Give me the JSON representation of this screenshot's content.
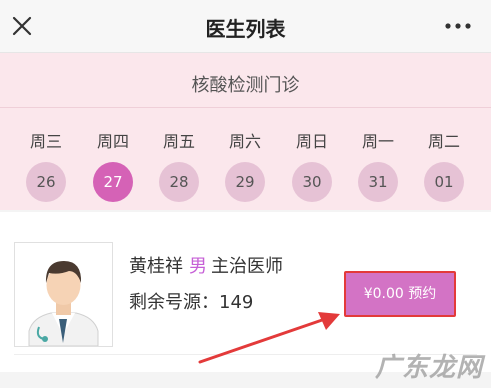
{
  "header": {
    "title": "医生列表",
    "close_icon": "close-icon",
    "more_icon": "more-dots-icon"
  },
  "clinic": {
    "name": "核酸检测门诊"
  },
  "week": [
    {
      "day": "周三",
      "date": "26",
      "selected": false
    },
    {
      "day": "周四",
      "date": "27",
      "selected": true
    },
    {
      "day": "周五",
      "date": "28",
      "selected": false
    },
    {
      "day": "周六",
      "date": "29",
      "selected": false
    },
    {
      "day": "周日",
      "date": "30",
      "selected": false
    },
    {
      "day": "周一",
      "date": "31",
      "selected": false
    },
    {
      "day": "周二",
      "date": "01",
      "selected": false
    }
  ],
  "doctor": {
    "name": "黄桂祥",
    "gender": "男",
    "title": "主治医师",
    "source_label": "剩余号源：",
    "source_count": "149",
    "book_label": "¥0.00 预约"
  },
  "colors": {
    "accent": "#d562b6",
    "button": "#d373c5",
    "highlight_border": "#e33a3a",
    "band": "#fbe7ec"
  },
  "watermark": "广东龙网"
}
